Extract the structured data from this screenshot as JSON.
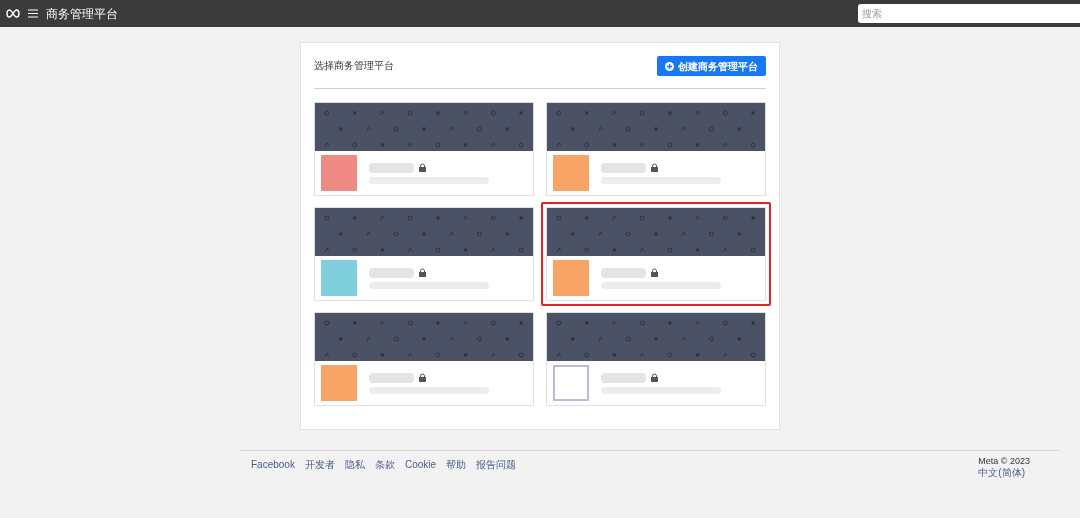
{
  "top_bar": {
    "title": "商务管理平台",
    "search": {
      "placeholder": "搜索"
    }
  },
  "panel": {
    "heading": "选择商务管理平台",
    "create_button": "创建商务管理平台",
    "accounts": [
      {
        "kind": "block",
        "color": "#f08a84",
        "selected": false
      },
      {
        "kind": "block",
        "color": "#f7a466",
        "selected": false
      },
      {
        "kind": "block",
        "color": "#7fd0dc",
        "selected": false
      },
      {
        "kind": "block",
        "color": "#f7a466",
        "selected": true
      },
      {
        "kind": "block",
        "color": "#f7a466",
        "selected": false
      },
      {
        "kind": "frame",
        "color": "#b7bdd8",
        "selected": false
      }
    ]
  },
  "footer": {
    "links": [
      "Facebook",
      "开发者",
      "隐私",
      "条款",
      "Cookie",
      "帮助",
      "报告问题"
    ],
    "copyright": "Meta © 2023",
    "language": "中文(简体)"
  }
}
